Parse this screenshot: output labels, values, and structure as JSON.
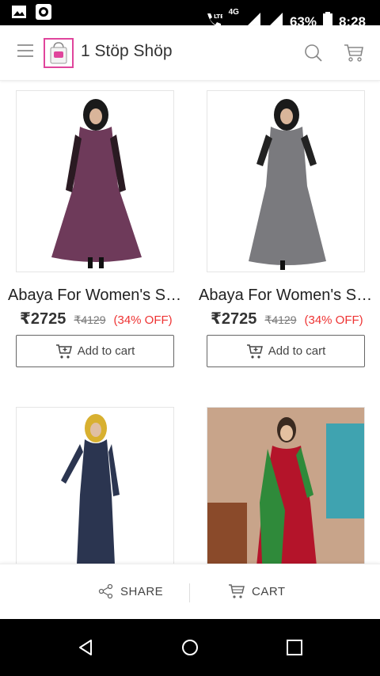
{
  "status": {
    "battery": "63%",
    "time": "8:28",
    "net_top": "4G",
    "lte": "LTE"
  },
  "header": {
    "title": "1 Stöp Shöp"
  },
  "products": [
    {
      "title": "Abaya For Women's SK…",
      "price": "₹2725",
      "mrp": "₹4129",
      "discount": "(34% OFF)",
      "button": "Add to cart",
      "dress_color": "#6e3a5a"
    },
    {
      "title": "Abaya For Women's SK…",
      "price": "₹2725",
      "mrp": "₹4129",
      "discount": "(34% OFF)",
      "button": "Add to cart",
      "dress_color": "#7a7a7e"
    },
    {
      "title": "",
      "dress_color": "#2b3550"
    },
    {
      "title": "",
      "dress_color": "#b4142a"
    }
  ],
  "actions": {
    "share": "SHARE",
    "cart": "CART"
  },
  "colors": {
    "accent": "#e0459c",
    "discount": "#e33"
  }
}
